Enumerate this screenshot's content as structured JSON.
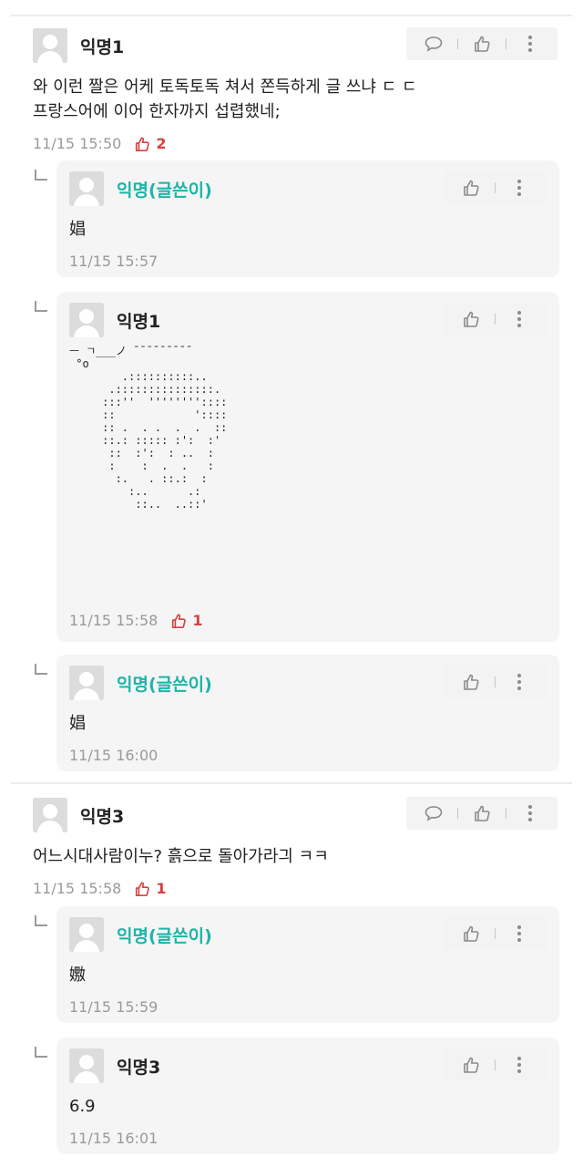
{
  "comments": [
    {
      "author": "익명1",
      "text_line1": "와 이런 짤은 어케 토독토독 쳐서 쫀득하게 글 쓰냐 ㄷ ㄷ",
      "text_line2": "프랑스어에 이어 한자까지 섭렵했네;",
      "time": "11/15 15:50",
      "likes": "2",
      "replies": [
        {
          "author": "익명(글쓴이)",
          "text": "娼",
          "time": "11/15 15:57"
        },
        {
          "author": "익명1",
          "ascii": "ㅡ ㄱ___ノ ̄ ̄ ̄ ̄ ̄ ̄ ̄ ̄ ̄\n °o\n        .::::::::::..\n      .:::::::::::::::.\n     :::''  ''''''''::::\n     ::            '::::\n     :: .  . .  .  .  ::\n     ::.: ::::: :':  :'\n      ::  :':  : ..  :\n      :    :  .  .   :\n       :.   . ::.:  :\n         :..      .:\n          ::..  ..::'",
          "time": "11/15 15:58",
          "likes": "1"
        },
        {
          "author": "익명(글쓴이)",
          "text": "娼",
          "time": "11/15 16:00"
        }
      ]
    },
    {
      "author": "익명3",
      "text": "어느시대사람이누? 흙으로 돌아가라긔 ㅋㅋ",
      "time": "11/15 15:58",
      "likes": "1",
      "replies": [
        {
          "author": "익명(글쓴이)",
          "text": "嫐",
          "time": "11/15 15:59"
        },
        {
          "author": "익명3",
          "text": "6.9",
          "time": "11/15 16:01"
        }
      ]
    }
  ],
  "icons": {
    "comment": "speech-bubble-icon",
    "like": "thumbs-up-icon",
    "more": "more-vertical-icon",
    "reply": "reply-arrow-icon",
    "avatar": "default-avatar"
  },
  "colors": {
    "op_author": "#1cb5a8",
    "likes": "#d64040"
  }
}
